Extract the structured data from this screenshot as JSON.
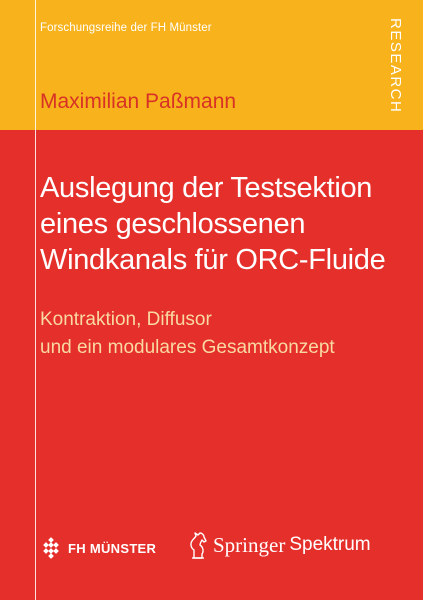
{
  "cover": {
    "series": "Forschungsreihe der FH Münster",
    "research_label": "RESEARCH",
    "author": "Maximilian Paßmann",
    "title_lines": [
      "Auslegung der Testsektion",
      "eines geschlossenen",
      "Windkanals für ORC-Fluide"
    ],
    "subtitle_lines": [
      "Kontraktion, Diffusor",
      "und ein modulares Gesamtkonzept"
    ],
    "fh_logo_text": "FH MÜNSTER",
    "publisher": "Springer",
    "imprint": "Spektrum"
  },
  "colors": {
    "top_band": "#f7b21c",
    "main_red": "#e52f2b",
    "author_text": "#d83226",
    "subtitle_text": "#f9d9a0",
    "white": "#ffffff"
  }
}
